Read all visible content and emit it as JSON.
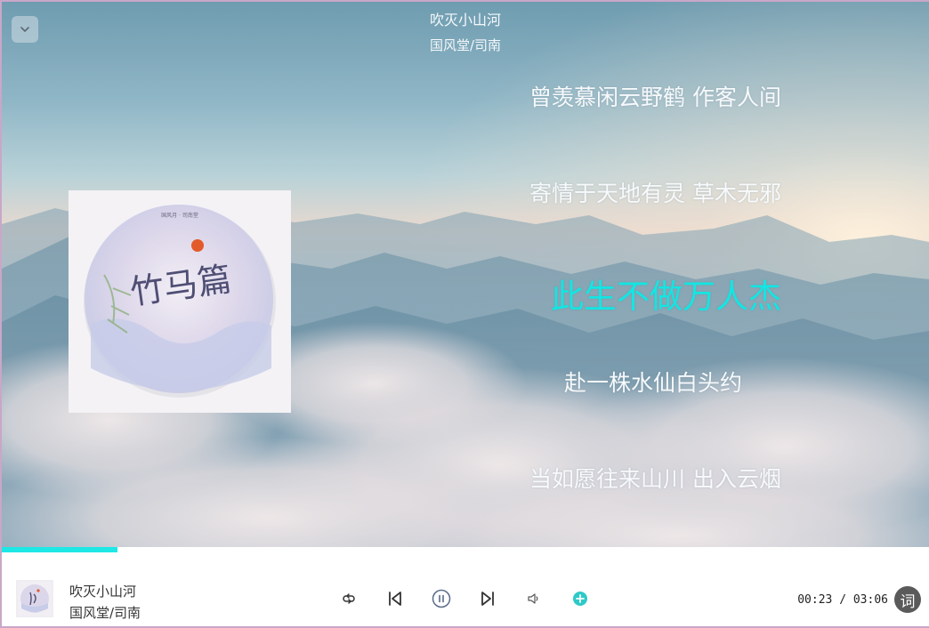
{
  "header": {
    "song_title": "吹灭小山河",
    "artist": "国风堂/司南"
  },
  "lyrics": {
    "lines": [
      "曾羡慕闲云野鹤  作客人间",
      "寄情于天地有灵  草木无邪",
      "此生不做万人杰",
      "赴一株水仙白头约",
      "当如愿往来山川  出入云烟"
    ],
    "active_index": 2
  },
  "cover_art": {
    "title_text": "竹马篇",
    "small_credit": "国风月 · 司南堂"
  },
  "playback": {
    "progress_fraction": 0.125,
    "current_time": "00:23",
    "separator": "/",
    "total_time": "03:06",
    "state": "playing"
  },
  "player_bar": {
    "song_title": "吹灭小山河",
    "artist": "国风堂/司南",
    "lyric_button_label": "词"
  },
  "icons": {
    "collapse": "chevron-down-icon",
    "repeat": "repeat-icon",
    "previous": "skip-previous-icon",
    "pause": "pause-icon",
    "next": "skip-next-icon",
    "volume": "volume-icon",
    "add": "add-icon"
  },
  "colors": {
    "accent": "#1de8e6",
    "active_lyric": "#12e6e3",
    "add_button": "#2ec9c7",
    "lyric_button_bg": "#5a5a5a"
  }
}
